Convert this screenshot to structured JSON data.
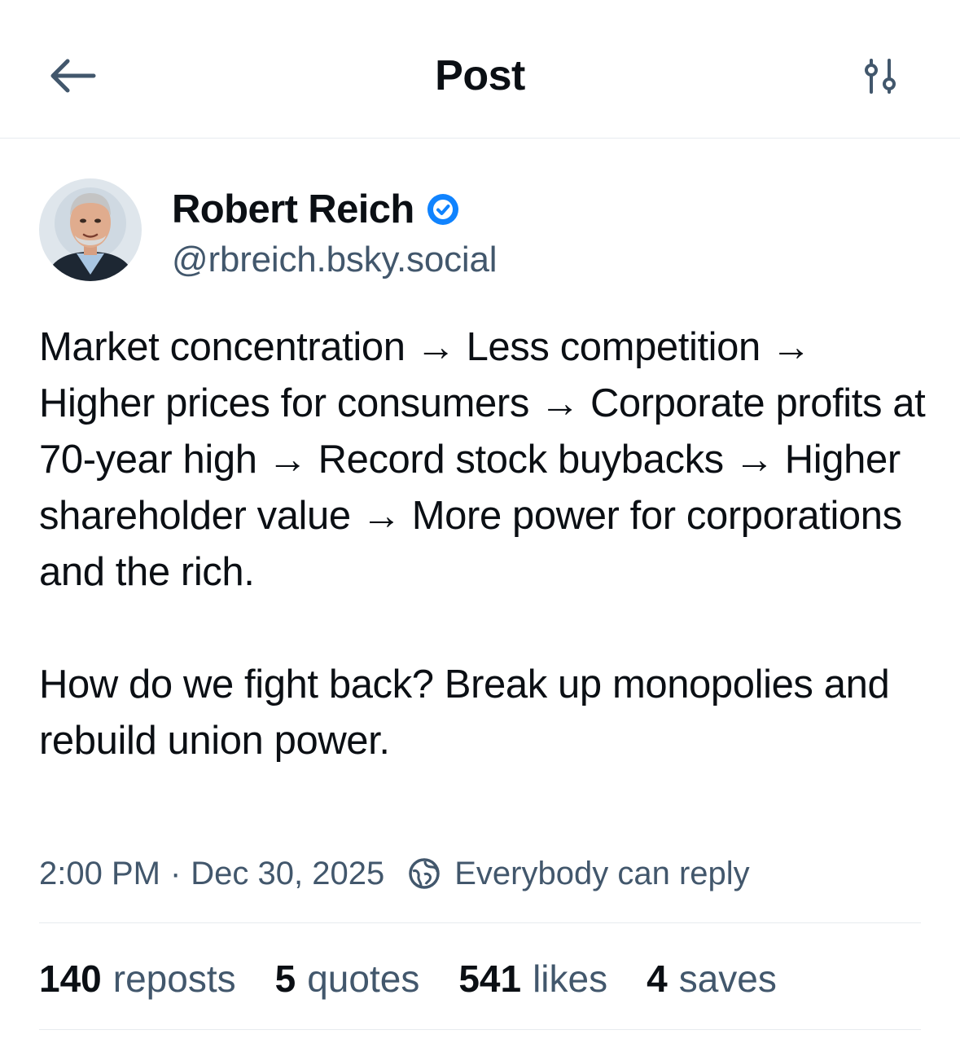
{
  "header": {
    "title": "Post",
    "back_icon": "arrow-left-icon",
    "settings_icon": "sliders-icon"
  },
  "author": {
    "name": "Robert Reich",
    "handle": "@rbreich.bsky.social",
    "verified": true,
    "verified_color": "#1083fe"
  },
  "post": {
    "paragraphs": [
      "Market concentration → Less competition → Higher prices for consumers → Corporate profits at 70-year high → Record stock buybacks → Higher shareholder value → More power for corporations and the rich.",
      "How do we fight back? Break up monopolies and rebuild union power."
    ],
    "time": "2:00 PM",
    "separator": "·",
    "date": "Dec 30, 2025",
    "reply_setting": "Everybody can reply",
    "reply_icon": "earth-icon"
  },
  "stats": {
    "reposts": {
      "count": "140",
      "label": "reposts"
    },
    "quotes": {
      "count": "5",
      "label": "quotes"
    },
    "likes": {
      "count": "541",
      "label": "likes"
    },
    "saves": {
      "count": "4",
      "label": "saves"
    }
  },
  "colors": {
    "text": "#0b0f14",
    "secondary_text": "#42576c",
    "divider": "#e7ebef",
    "accent": "#1083fe"
  }
}
